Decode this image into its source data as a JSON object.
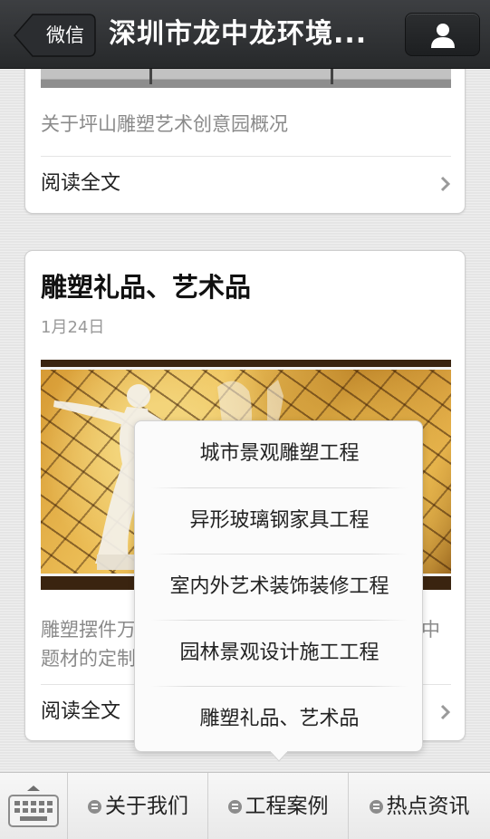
{
  "navbar": {
    "back_label": "微信",
    "title": "深圳市龙中龙环境...",
    "profile_icon": "person-icon"
  },
  "articles": [
    {
      "summary": "关于坪山雕塑艺术创意园概况",
      "read_more": "阅读全文"
    },
    {
      "title": "雕塑礼品、艺术品",
      "date": "1月24日",
      "summary": "雕塑摆件万　　　　　　　　　　　　　　　中\n题材的定制",
      "read_more": "阅读全文"
    }
  ],
  "popup_menu": {
    "items": [
      "城市景观雕塑工程",
      "异形玻璃钢家具工程",
      "室内外艺术装饰装修工程",
      "园林景观设计施工工程",
      "雕塑礼品、艺术品"
    ]
  },
  "bottom_menu": {
    "keyboard_icon": "keyboard-icon",
    "tabs": [
      "关于我们",
      "工程案例",
      "热点资讯"
    ]
  },
  "colors": {
    "navbar": "#2e3033",
    "page_bg": "#e9e9e9",
    "card_bg": "#ffffff"
  }
}
